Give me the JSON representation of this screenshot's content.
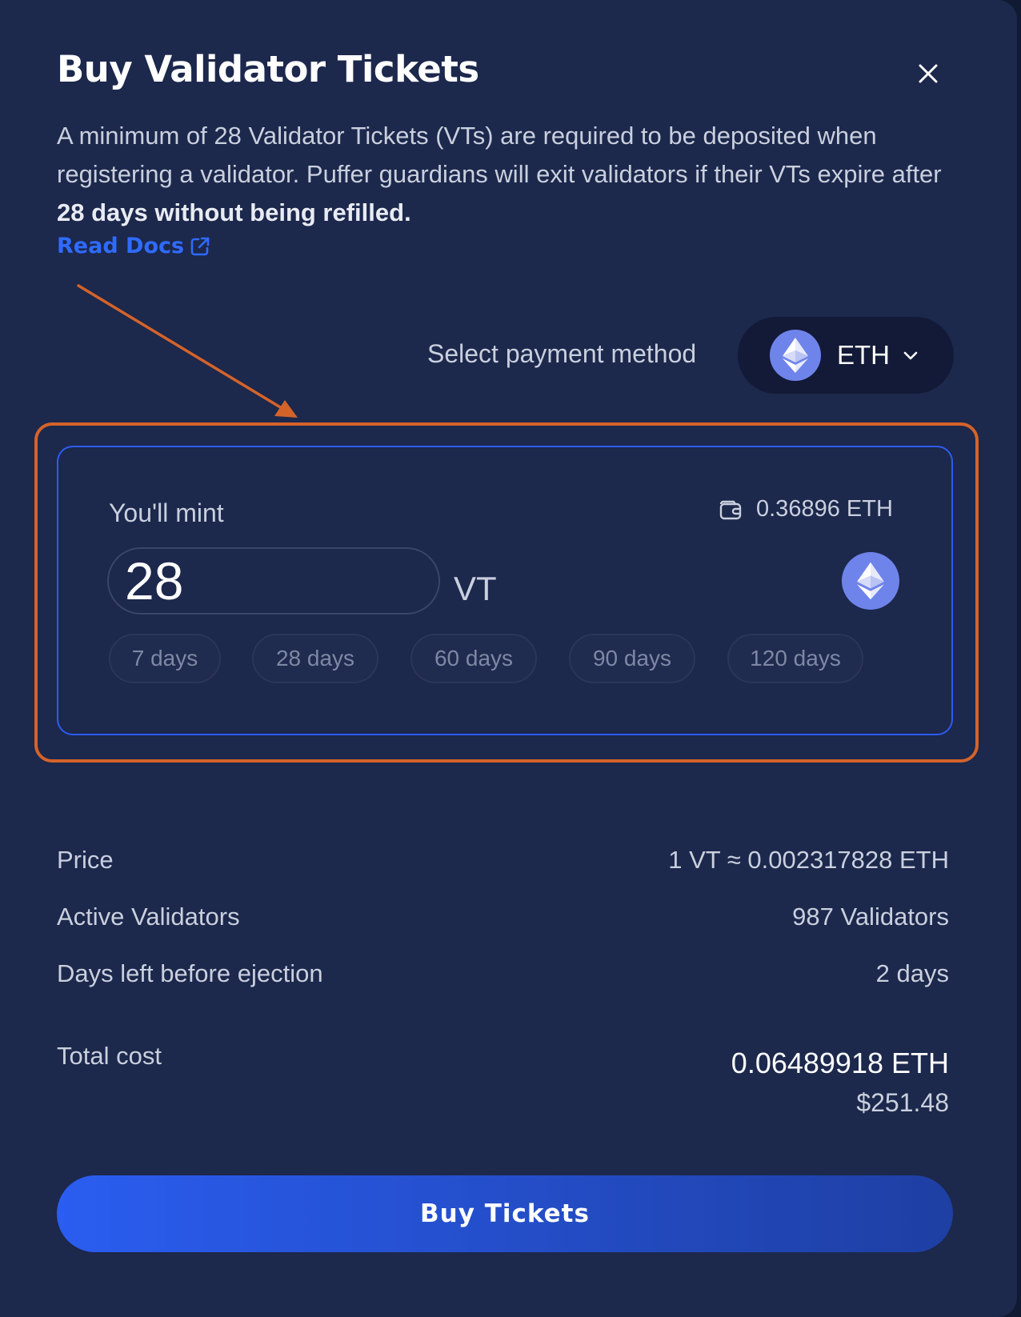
{
  "modal": {
    "title": "Buy Validator Tickets",
    "description_part1": "A minimum of 28 Validator Tickets (VTs) are required to be deposited when registering a validator. Puffer guardians will exit validators if their VTs expire after ",
    "description_bold": "28 days without being refilled.",
    "read_docs_label": "Read Docs"
  },
  "payment": {
    "label": "Select payment method",
    "selected": "ETH"
  },
  "mint": {
    "label": "You'll mint",
    "balance": "0.36896 ETH",
    "amount": "28",
    "unit": "VT",
    "presets": [
      "7 days",
      "28 days",
      "60 days",
      "90 days",
      "120 days"
    ]
  },
  "summary": {
    "price_label": "Price",
    "price_value": "1 VT ≈ 0.002317828 ETH",
    "active_label": "Active Validators",
    "active_value": "987 Validators",
    "days_left_label": "Days left before ejection",
    "days_left_value": "2 days",
    "total_label": "Total cost",
    "total_eth": "0.06489918 ETH",
    "total_usd": "$251.48"
  },
  "actions": {
    "buy_label": "Buy Tickets"
  },
  "colors": {
    "background": "#1c284c",
    "accent": "#2a5df0",
    "link": "#2f6bff",
    "annotation": "#d4632a",
    "eth_icon": "#6f84ea"
  },
  "icons": {
    "close": "close-icon",
    "external": "external-link-icon",
    "eth": "ethereum-icon",
    "chevron": "chevron-down-icon",
    "wallet": "wallet-icon"
  }
}
